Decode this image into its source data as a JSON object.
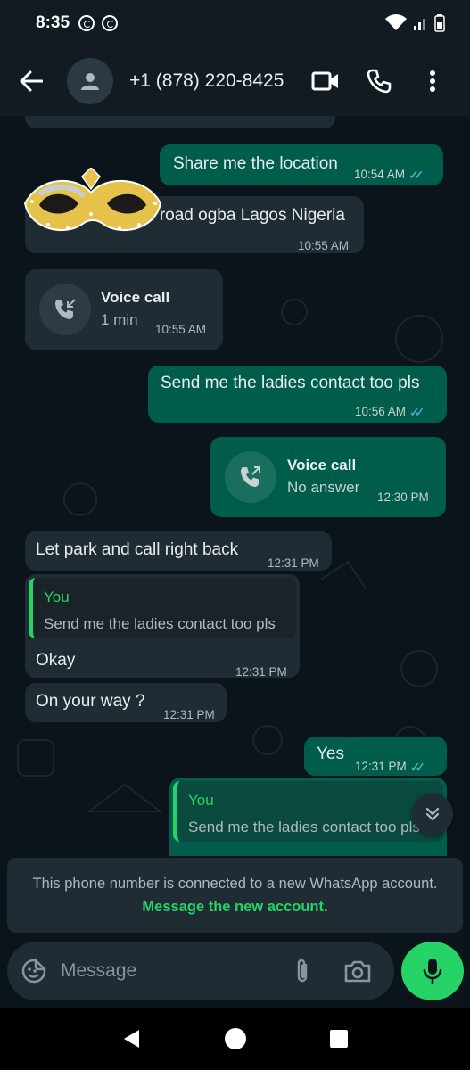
{
  "status_bar": {
    "time": "8:35"
  },
  "header": {
    "contact": "+1 (878) 220-8425",
    "icons": [
      "back-arrow-icon",
      "avatar-icon",
      "video-call-icon",
      "phone-icon",
      "more-vert-icon"
    ]
  },
  "messages": {
    "m1": {
      "text": "Share me the location",
      "time": "10:54 AM"
    },
    "m2": {
      "text": "n road ogba Lagos Nigeria",
      "time": "10:55 AM"
    },
    "m3": {
      "title": "Voice call",
      "sub": "1 min",
      "time": "10:55 AM"
    },
    "m4": {
      "text": "Send me the ladies contact too pls",
      "time": "10:56 AM"
    },
    "m5": {
      "title": "Voice call",
      "sub": "No answer",
      "time": "12:30 PM"
    },
    "m6": {
      "text": "Let park and call right back",
      "time": "12:31 PM"
    },
    "m7": {
      "quote_author": "You",
      "quote_text": "Send me the ladies contact too pls",
      "text": "Okay",
      "time": "12:31 PM"
    },
    "m8": {
      "text": "On your way ?",
      "time": "12:31 PM"
    },
    "m9": {
      "text": "Yes",
      "time": "12:31 PM"
    },
    "m10": {
      "quote_author": "You",
      "quote_text": "Send me the ladies contact too pls"
    }
  },
  "notice": {
    "text": "This phone number is connected to a new WhatsApp account.",
    "link": "Message the new account."
  },
  "composer": {
    "placeholder": "Message"
  },
  "colors": {
    "accent": "#25d366",
    "outgoing_bubble": "#005c4b",
    "incoming_bubble": "#202c33",
    "read_ticks": "#53bdeb",
    "background": "#0b141a"
  }
}
